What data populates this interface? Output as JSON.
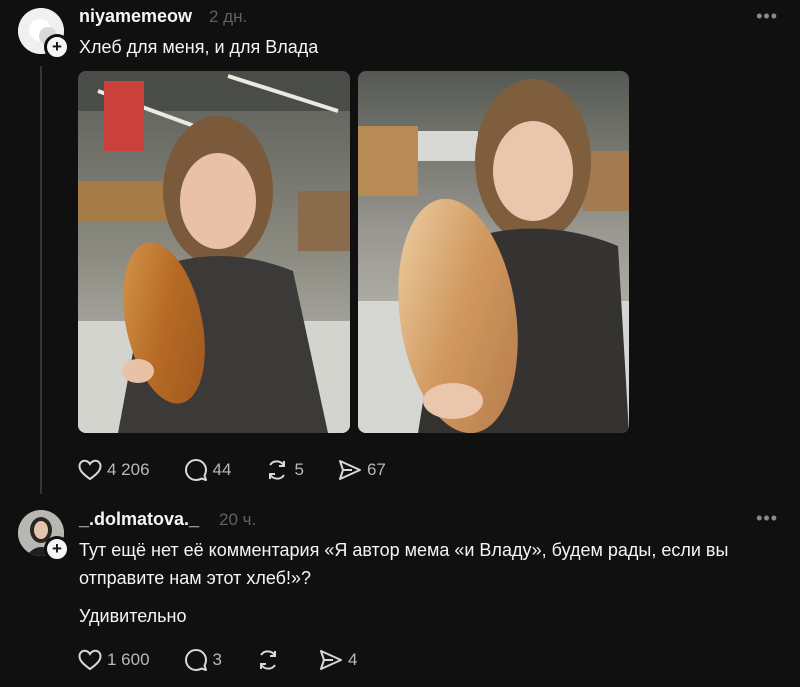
{
  "post1": {
    "username": "niyamemeow",
    "time": "2 дн.",
    "text": "Хлеб для меня, и для Влада",
    "more_icon": "more-icon",
    "images": [
      "selfie-with-bread-photo",
      "bread-closeup-photo"
    ],
    "stats": {
      "likes": "4 206",
      "comments": "44",
      "reposts": "5",
      "shares": "67"
    }
  },
  "post2": {
    "username": "_.dolmatova._",
    "time": "20 ч.",
    "text": "Тут ещё нет её комментария «Я автор мема «и Владу», будем рады, если вы отправите нам этот хлеб!»?",
    "text2": "Удивительно",
    "more_icon": "more-icon",
    "stats": {
      "likes": "1 600",
      "comments": "3",
      "reposts": "",
      "shares": "4"
    }
  },
  "colors": {
    "background": "#101010",
    "text": "#f3f5f7",
    "muted": "#616161",
    "thread_line": "#333638"
  }
}
